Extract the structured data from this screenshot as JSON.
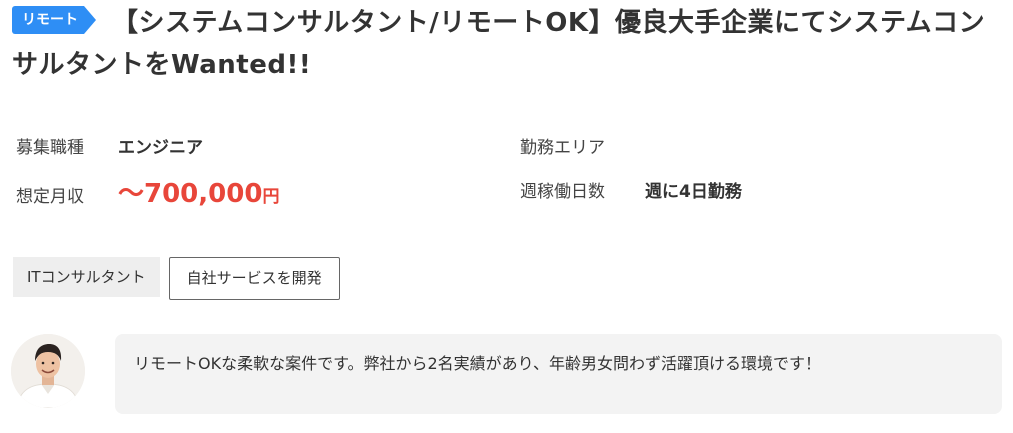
{
  "job": {
    "badge_label": "リモート",
    "title": "【システムコンサルタント/リモートOK】優良大手企業にてシステムコンサルタントをWanted!!"
  },
  "info": {
    "job_type_label": "募集職種",
    "job_type_value": "エンジニア",
    "area_label": "勤務エリア",
    "area_value": "",
    "salary_label": "想定月収",
    "salary_value": "〜700,000",
    "salary_unit": "円",
    "days_label": "週稼働日数",
    "days_value": "週に4日勤務"
  },
  "tags": {
    "tag1": "ITコンサルタント",
    "tag2": "自社サービスを開発"
  },
  "message": {
    "text": "リモートOKな柔軟な案件です。弊社から2名実績があり、年齢男女問わず活躍頂ける環境です！"
  },
  "colors": {
    "badge": "#2e8ef5",
    "salary": "#e8463a",
    "bubble_bg": "#f3f3f3"
  }
}
